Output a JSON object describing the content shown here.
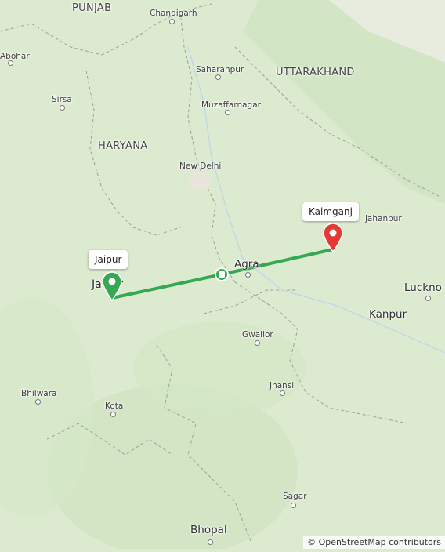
{
  "map": {
    "states": [
      "PUNJAB",
      "UTTARAKHAND",
      "HARYANA"
    ],
    "cities": {
      "chandigarh": "Chandigarh",
      "abohar": "Abohar",
      "saharanpur": "Saharanpur",
      "sirsa": "Sirsa",
      "muzaffarnagar": "Muzaffarnagar",
      "new_delhi": "New Delhi",
      "shahjahanpur_partial": "jahanpur",
      "agra": "Agra",
      "jaipur": "Jaipur",
      "lucknow_partial": "Luckno",
      "kanpur": "Kanpur",
      "gwalior": "Gwalior",
      "jhansi": "Jhansi",
      "bhilwara": "Bhilwara",
      "kota": "Kota",
      "sagar": "Sagar",
      "bhopal": "Bhopal"
    },
    "route_markers": {
      "start_label": "Jaipur",
      "end_label": "Kaimganj"
    },
    "colors": {
      "land": "#dcebcf",
      "route": "#34a853",
      "start_marker": "#34a853",
      "end_marker": "#e53935",
      "borders": "#9aa394"
    },
    "attribution": "© OpenStreetMap contributors"
  }
}
